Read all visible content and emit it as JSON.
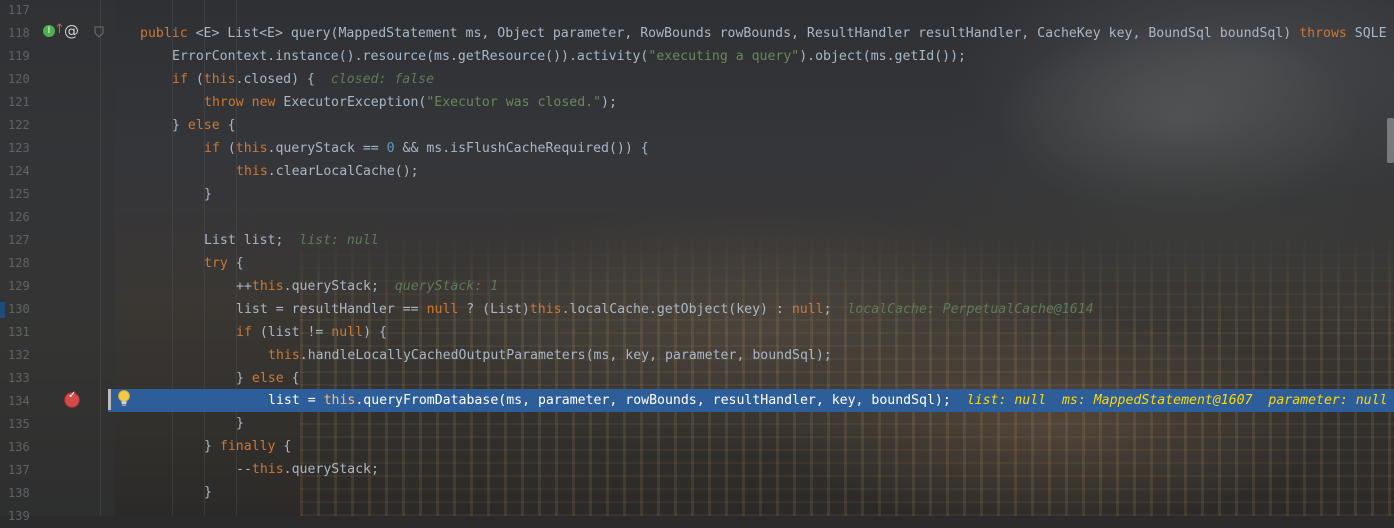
{
  "editor": {
    "gutter": {
      "line_numbers": [
        "117",
        "118",
        "119",
        "120",
        "121",
        "122",
        "123",
        "124",
        "125",
        "126",
        "127",
        "128",
        "129",
        "130",
        "131",
        "132",
        "133",
        "134",
        "135",
        "136",
        "137",
        "138",
        "139"
      ],
      "icons": {
        "implements": "implements-icon",
        "override_up": "overrides-arrow-icon",
        "annotation": "at-annotation-icon",
        "fold": "fold-marker-icon",
        "breakpoint": "breakpoint-icon",
        "intention": "lightbulb-icon"
      }
    },
    "lines": {
      "l118": {
        "kw_public": "public",
        "sig_a": " <E> List<E> query(MappedStatement ms, Object parameter, RowBounds rowBounds, ResultHandler resultHandler, CacheKey key, BoundSql boundSql) ",
        "kw_throws": "throws",
        "sig_b": " SQLE"
      },
      "l119": {
        "text_a": "ErrorContext.instance().resource(ms.getResource()).activity(",
        "str": "\"executing a query\"",
        "text_b": ").object(ms.getId());"
      },
      "l120": {
        "kw_if": "if",
        "text_a": " (",
        "kw_this": "this",
        "text_b": ".closed) {  ",
        "hint": "closed: false"
      },
      "l121": {
        "kw_throw": "throw",
        "sp": " ",
        "kw_new": "new",
        "text_a": " ExecutorException(",
        "str": "\"Executor was closed.\"",
        "text_b": ");"
      },
      "l122": {
        "text_a": "} ",
        "kw_else": "else",
        "text_b": " {"
      },
      "l123": {
        "kw_if": "if",
        "text_a": " (",
        "kw_this": "this",
        "text_b": ".queryStack == ",
        "num": "0",
        "text_c": " && ms.isFlushCacheRequired()) {"
      },
      "l124": {
        "kw_this": "this",
        "text_a": ".clearLocalCache();"
      },
      "l125": {
        "text_a": "}"
      },
      "l127": {
        "text_a": "List list;  ",
        "hint": "list: null"
      },
      "l128": {
        "kw_try": "try",
        "text_a": " {"
      },
      "l129": {
        "text_a": "++",
        "kw_this": "this",
        "text_b": ".queryStack;  ",
        "hint": "queryStack: 1"
      },
      "l130": {
        "text_a": "list = resultHandler == ",
        "kw_null": "null",
        "text_b": " ? (List)",
        "kw_this": "this",
        "text_c": ".localCache.getObject(key) : ",
        "kw_null2": "null",
        "text_d": ";  ",
        "hint": "localCache: PerpetualCache@1614"
      },
      "l131": {
        "kw_if": "if",
        "text_a": " (list != ",
        "kw_null": "null",
        "text_b": ") {"
      },
      "l132": {
        "kw_this": "this",
        "text_a": ".handleLocallyCachedOutputParameters(ms, key, parameter, boundSql);"
      },
      "l133": {
        "text_a": "} ",
        "kw_else": "else",
        "text_b": " {"
      },
      "l134": {
        "text_a": "list = ",
        "kw_this": "this",
        "text_b": ".queryFromDatabase(ms, parameter, rowBounds, resultHandler, key, boundSql);  ",
        "hint": "list: null  ms: MappedStatement@1607  parameter: null"
      },
      "l135": {
        "text_a": "}"
      },
      "l136": {
        "text_a": "} ",
        "kw_finally": "finally",
        "text_b": " {"
      },
      "l137": {
        "text_a": "--",
        "kw_this": "this",
        "text_b": ".queryStack;"
      },
      "l138": {
        "text_a": "}"
      }
    }
  }
}
